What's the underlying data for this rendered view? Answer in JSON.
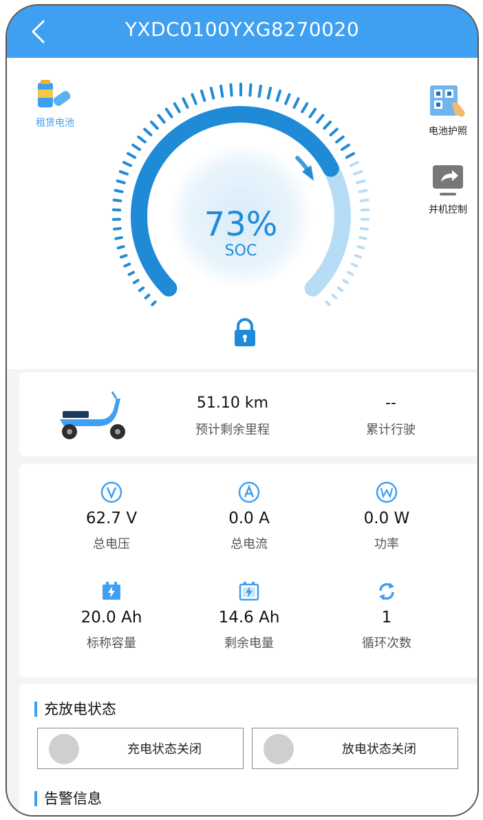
{
  "header": {
    "title": "YXDC0100YXG8270020"
  },
  "side_buttons": {
    "rent_label": "租赁电池",
    "passport_label": "电池护照",
    "parallel_label": "并机控制"
  },
  "soc": {
    "percent": "73%",
    "label": "SOC",
    "level": 0.73
  },
  "range": {
    "remaining_value": "51.10 km",
    "remaining_label": "预计剩余里程",
    "total_value": "--",
    "total_label": "累计行驶"
  },
  "metrics": [
    {
      "icon": "voltage-icon",
      "value": "62.7 V",
      "label": "总电压"
    },
    {
      "icon": "current-icon",
      "value": "0.0 A",
      "label": "总电流"
    },
    {
      "icon": "power-icon",
      "value": "0.0 W",
      "label": "功率"
    },
    {
      "icon": "battery-capacity-icon",
      "value": "20.0 Ah",
      "label": "标称容量"
    },
    {
      "icon": "battery-remaining-icon",
      "value": "14.6 Ah",
      "label": "剩余电量"
    },
    {
      "icon": "cycle-icon",
      "value": "1",
      "label": "循环次数"
    }
  ],
  "charge_section": {
    "title": "充放电状态",
    "charge_state": "充电状态关闭",
    "discharge_state": "放电状态关闭"
  },
  "alarm_section": {
    "title": "告警信息"
  },
  "colors": {
    "accent": "#3f9ff0",
    "gauge_dark": "#1f8ad6",
    "gauge_light": "#b7dcf5"
  }
}
